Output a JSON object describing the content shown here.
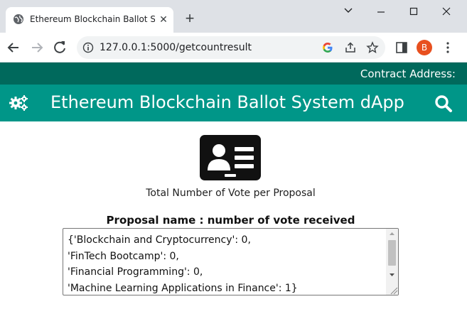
{
  "browser": {
    "tab_title": "Ethereum Blockchain Ballot Syste",
    "tab_close": "✕",
    "new_tab": "+",
    "url": "127.0.0.1:5000/getcountresult",
    "profile_initial": "B"
  },
  "app": {
    "contract_label": "Contract Address:",
    "title": "Ethereum Blockchain Ballot System dApp",
    "header_color": "#009688",
    "contract_bar_color": "#00695c"
  },
  "results": {
    "subtitle": "Total Number of Vote per Proposal",
    "heading": "Proposal name : number of vote received",
    "text": "{'Blockchain and Cryptocurrency': 0,\n'FinTech Bootcamp': 0,\n'Financial Programming': 0,\n'Machine Learning Applications in Finance': 1}"
  },
  "icons": {
    "favicon": "globe-icon",
    "app_menu": "gears-icon",
    "search": "search-icon",
    "card": "id-card-icon"
  }
}
